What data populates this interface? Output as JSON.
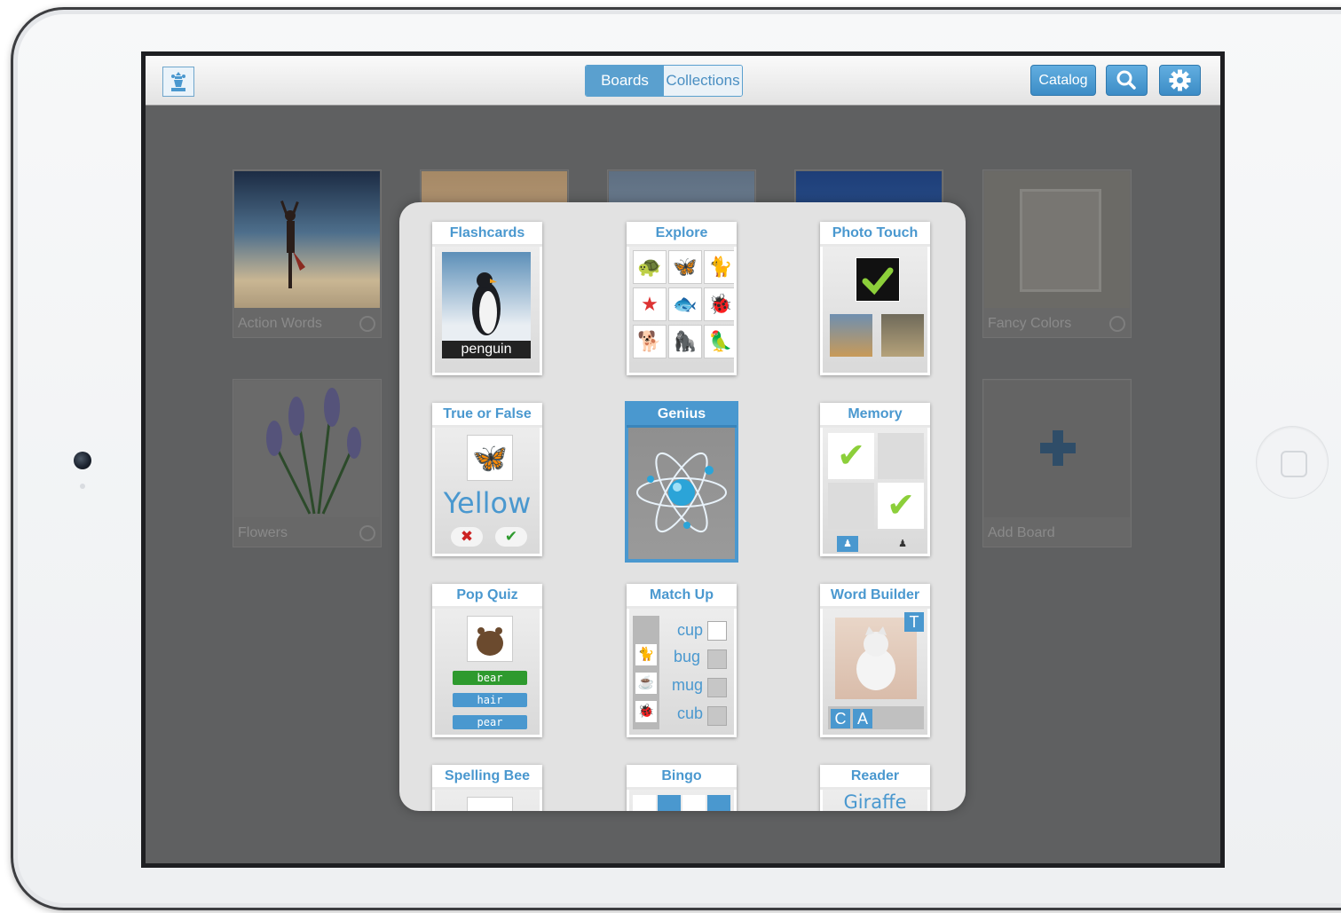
{
  "topbar": {
    "tabs": [
      {
        "label": "Boards",
        "active": true
      },
      {
        "label": "Collections",
        "active": false
      }
    ],
    "catalog_label": "Catalog",
    "search_icon": "search-icon",
    "settings_icon": "gear-icon",
    "logo_icon": "chess-pawn-icon"
  },
  "boards": [
    {
      "label": "Action Words"
    },
    {
      "label": "Fancy Colors"
    },
    {
      "label": "Flowers"
    },
    {
      "label": "Add Board"
    }
  ],
  "activities": {
    "flashcards": {
      "title": "Flashcards",
      "caption": "penguin"
    },
    "explore": {
      "title": "Explore"
    },
    "photo_touch": {
      "title": "Photo Touch"
    },
    "true_false": {
      "title": "True or False",
      "word": "Yellow"
    },
    "genius": {
      "title": "Genius",
      "selected": true
    },
    "memory": {
      "title": "Memory"
    },
    "pop_quiz": {
      "title": "Pop Quiz",
      "options": [
        "bear",
        "hair",
        "pear"
      ]
    },
    "match_up": {
      "title": "Match Up",
      "words": [
        "cup",
        "bug",
        "mug",
        "cub"
      ]
    },
    "word_builder": {
      "title": "Word Builder",
      "hint_letter": "T",
      "letters": [
        "C",
        "A"
      ]
    },
    "spelling_bee": {
      "title": "Spelling Bee"
    },
    "bingo": {
      "title": "Bingo"
    },
    "reader": {
      "title": "Reader",
      "word": "Giraffe"
    }
  },
  "colors": {
    "accent": "#4a98cf",
    "correct": "#2e9a2e"
  }
}
